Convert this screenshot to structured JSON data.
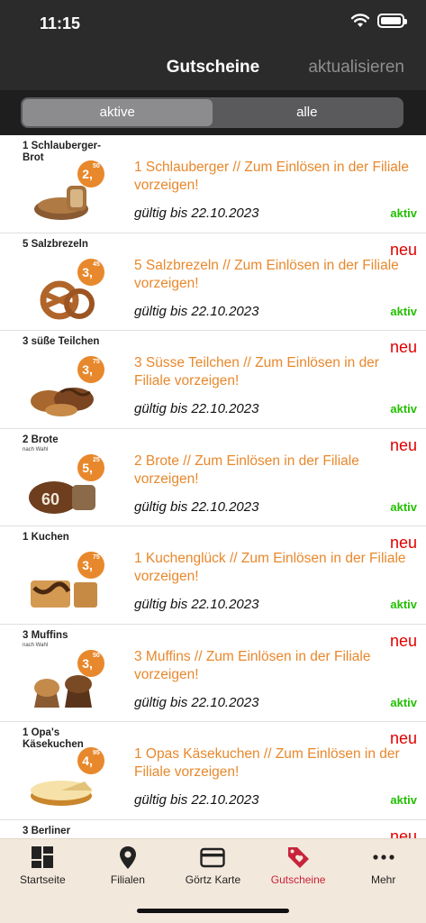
{
  "status_bar": {
    "time": "11:15"
  },
  "nav": {
    "title": "Gutscheine",
    "refresh_label": "aktualisieren"
  },
  "segments": [
    "aktive",
    "alle"
  ],
  "vouchers": [
    {
      "thumb_title": "1 Schlauberger-Brot",
      "thumb_sub": "",
      "price_main": "2,",
      "price_cents": "50",
      "price_sign": "€",
      "badge": "",
      "description": "1 Schlauberger // Zum Einlösen in der Filiale vorzeigen!",
      "validity": "gültig bis 22.10.2023",
      "status": "aktiv",
      "art": "bread"
    },
    {
      "thumb_title": "5 Salzbrezeln",
      "thumb_sub": "",
      "price_main": "3,",
      "price_cents": "45",
      "price_sign": "€",
      "badge": "neu",
      "description": "5 Salzbrezeln // Zum Einlösen in der Filiale vorzeigen!",
      "validity": "gültig bis 22.10.2023",
      "status": "aktiv",
      "art": "pretzel"
    },
    {
      "thumb_title": "3 süße Teilchen",
      "thumb_sub": "",
      "price_main": "3,",
      "price_cents": "75",
      "price_sign": "€",
      "badge": "neu",
      "description": "3 Süsse Teilchen // Zum Einlösen in der Filiale vorzeigen!",
      "validity": "gültig bis 22.10.2023",
      "status": "aktiv",
      "art": "pastry"
    },
    {
      "thumb_title": "2 Brote",
      "thumb_sub": "nach Wahl",
      "price_main": "5,",
      "price_cents": "25",
      "price_sign": "€",
      "badge": "neu",
      "description": "2 Brote // Zum Einlösen in der Filiale vorzeigen!",
      "validity": "gültig bis 22.10.2023",
      "status": "aktiv",
      "art": "loaf"
    },
    {
      "thumb_title": "1 Kuchen",
      "thumb_sub": "",
      "price_main": "3,",
      "price_cents": "75",
      "price_sign": "€",
      "badge": "neu",
      "description": "1 Kuchenglück // Zum Einlösen in der Filiale vorzeigen!",
      "validity": "gültig bis 22.10.2023",
      "status": "aktiv",
      "art": "cake"
    },
    {
      "thumb_title": "3 Muffins",
      "thumb_sub": "nach Wahl",
      "price_main": "3,",
      "price_cents": "50",
      "price_sign": "€",
      "badge": "neu",
      "description": "3 Muffins // Zum Einlösen in der Filiale vorzeigen!",
      "validity": "gültig bis 22.10.2023",
      "status": "aktiv",
      "art": "muffin"
    },
    {
      "thumb_title": "1 Opa's Käsekuchen",
      "thumb_sub": "",
      "price_main": "4,",
      "price_cents": "95",
      "price_sign": "€",
      "badge": "neu",
      "description": "1 Opas Käsekuchen // Zum Einlösen in der Filiale vorzeigen!",
      "validity": "gültig bis 22.10.2023",
      "status": "aktiv",
      "art": "cheesecake"
    },
    {
      "thumb_title": "3 Berliner",
      "thumb_sub": "",
      "price_main": "",
      "price_cents": "",
      "price_sign": "",
      "badge": "neu",
      "description": "",
      "validity": "",
      "status": "",
      "art": "none"
    }
  ],
  "tabs": [
    {
      "label": "Startseite",
      "icon": "dashboard-icon"
    },
    {
      "label": "Filialen",
      "icon": "location-pin-icon"
    },
    {
      "label": "Görtz Karte",
      "icon": "card-icon"
    },
    {
      "label": "Gutscheine",
      "icon": "tag-heart-icon"
    },
    {
      "label": "Mehr",
      "icon": "more-icon"
    }
  ],
  "colors": {
    "accent": "#e8882c",
    "badge_new": "#e00000",
    "status_active": "#22c000",
    "tab_active": "#c8233a",
    "header_bg": "#2b2b2b"
  }
}
